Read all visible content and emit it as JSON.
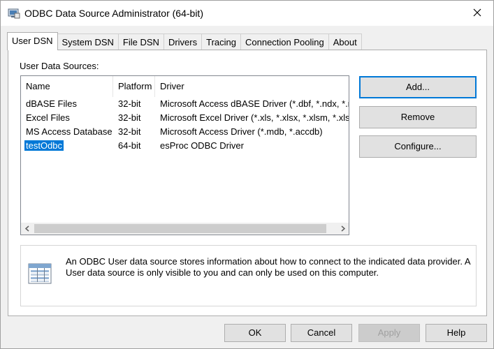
{
  "window": {
    "title": "ODBC Data Source Administrator (64-bit)"
  },
  "tabs": [
    {
      "label": "User DSN",
      "active": true
    },
    {
      "label": "System DSN",
      "active": false
    },
    {
      "label": "File DSN",
      "active": false
    },
    {
      "label": "Drivers",
      "active": false
    },
    {
      "label": "Tracing",
      "active": false
    },
    {
      "label": "Connection Pooling",
      "active": false
    },
    {
      "label": "About",
      "active": false
    }
  ],
  "user_dsn": {
    "section_label": "User Data Sources:",
    "columns": [
      "Name",
      "Platform",
      "Driver"
    ],
    "rows": [
      {
        "name": "dBASE Files",
        "platform": "32-bit",
        "driver": "Microsoft Access dBASE Driver (*.dbf, *.ndx, *.m"
      },
      {
        "name": "Excel Files",
        "platform": "32-bit",
        "driver": "Microsoft Excel Driver (*.xls, *.xlsx, *.xlsm, *.xlsb)"
      },
      {
        "name": "MS Access Database",
        "platform": "32-bit",
        "driver": "Microsoft Access Driver (*.mdb, *.accdb)"
      },
      {
        "name": "testOdbc",
        "platform": "64-bit",
        "driver": "esProc ODBC Driver",
        "selected": true
      }
    ],
    "buttons": {
      "add": "Add...",
      "remove": "Remove",
      "configure": "Configure..."
    },
    "info_text": "An ODBC User data source stores information about how to connect to the indicated data provider.   A User data source is only visible to you and can only be used on this computer."
  },
  "footer": {
    "ok": "OK",
    "cancel": "Cancel",
    "apply": "Apply",
    "help": "Help"
  },
  "colors": {
    "selection": "#0078d7",
    "default_button_border": "#0078d7",
    "window_bg": "#f0f0f0"
  },
  "icons": {
    "title": "odbc-admin-icon",
    "close": "close-icon",
    "info": "data-source-info-icon",
    "scroll_left": "chevron-left-icon",
    "scroll_right": "chevron-right-icon"
  }
}
